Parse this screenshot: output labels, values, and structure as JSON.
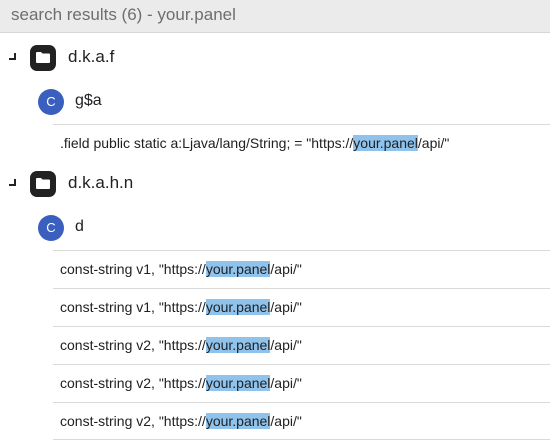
{
  "header": {
    "title": "search results (6) - your.panel"
  },
  "highlight_color": "#8fc3ec",
  "groups": [
    {
      "package": "d.k.a.f",
      "class": {
        "icon_letter": "C",
        "name": "g$a"
      },
      "results": [
        {
          "before": ".field public static a:Ljava/lang/String; = \"https://",
          "match": "your.panel",
          "after": "/api/\""
        }
      ]
    },
    {
      "package": "d.k.a.h.n",
      "class": {
        "icon_letter": "C",
        "name": "d"
      },
      "results": [
        {
          "before": "const-string v1, \"https://",
          "match": "your.panel",
          "after": "/api/\""
        },
        {
          "before": "const-string v1, \"https://",
          "match": "your.panel",
          "after": "/api/\""
        },
        {
          "before": "const-string v2, \"https://",
          "match": "your.panel",
          "after": "/api/\""
        },
        {
          "before": "const-string v2, \"https://",
          "match": "your.panel",
          "after": "/api/\""
        },
        {
          "before": "const-string v2, \"https://",
          "match": "your.panel",
          "after": "/api/\""
        }
      ]
    }
  ]
}
